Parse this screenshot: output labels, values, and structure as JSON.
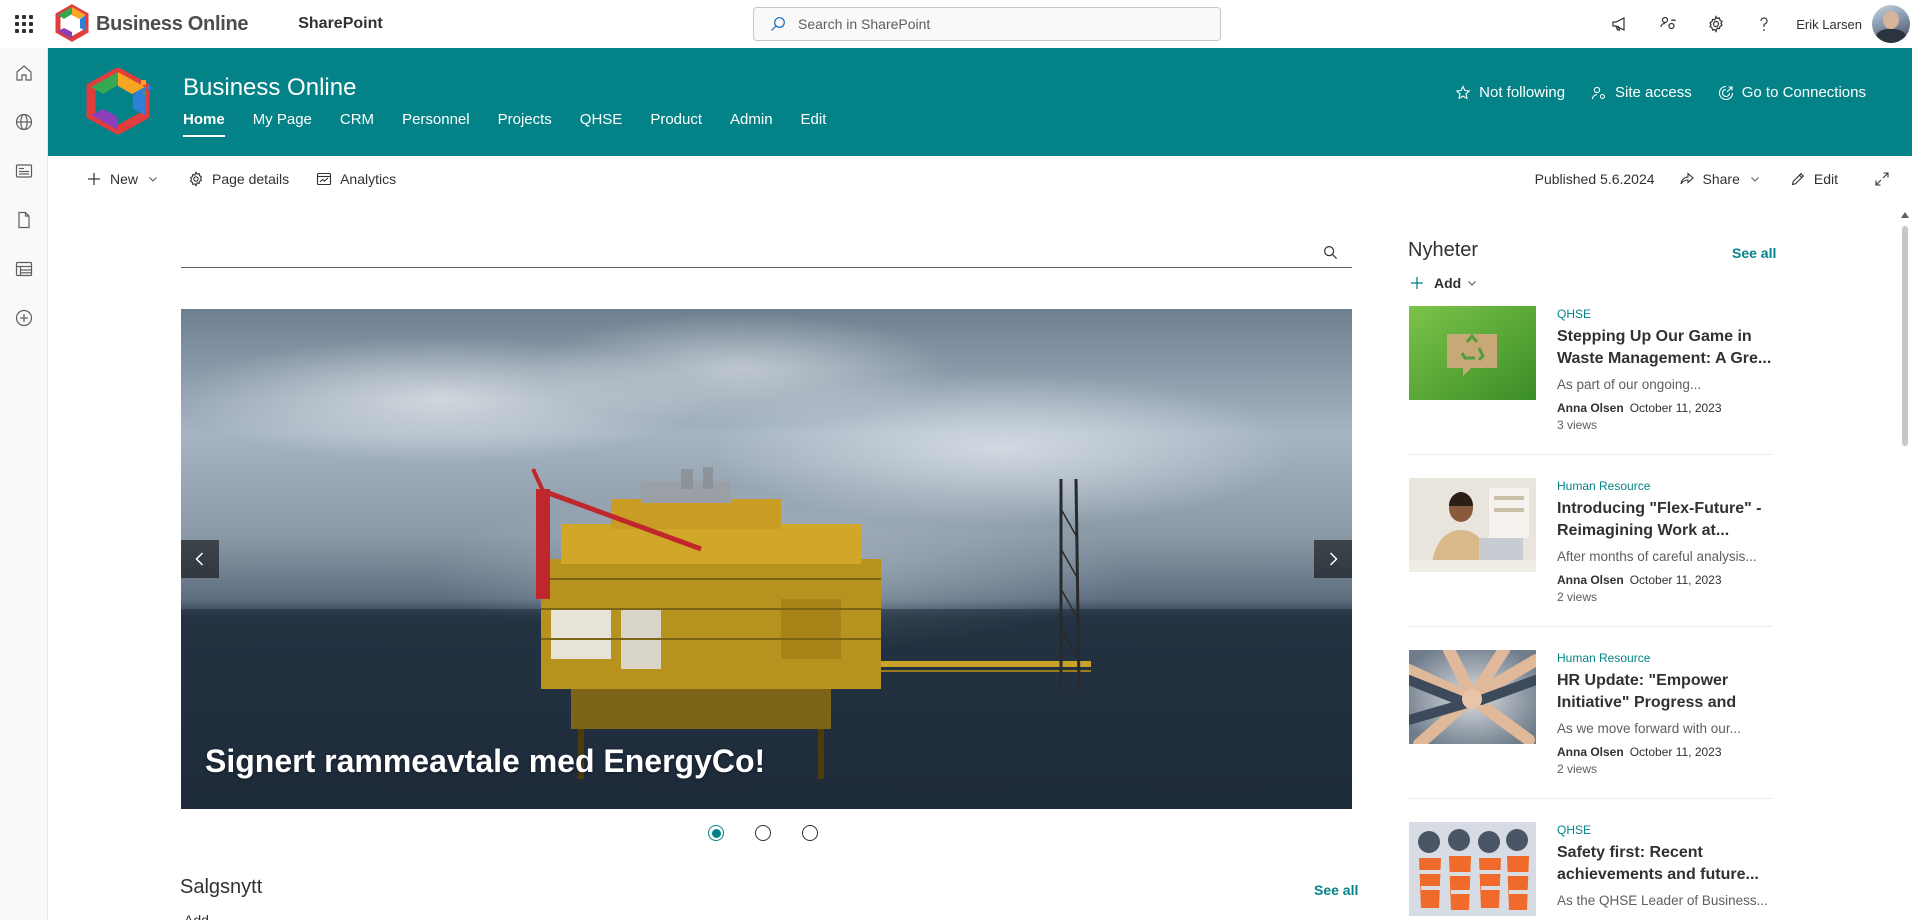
{
  "suite": {
    "brand": "Business Online",
    "app": "SharePoint",
    "search_placeholder": "Search in SharePoint",
    "user_name": "Erik Larsen"
  },
  "site": {
    "title": "Business Online",
    "nav": [
      "Home",
      "My Page",
      "CRM",
      "Personnel",
      "Projects",
      "QHSE",
      "Product",
      "Admin",
      "Edit"
    ],
    "active_nav": "Home",
    "actions": {
      "follow": "Not following",
      "access": "Site access",
      "connections": "Go to Connections"
    },
    "accent": "#038387"
  },
  "commandbar": {
    "new": "New",
    "page_details": "Page details",
    "analytics": "Analytics",
    "published": "Published 5.6.2024",
    "share": "Share",
    "edit": "Edit"
  },
  "hero": {
    "title": "Signert rammeavtale med EnergyCo!",
    "slide_count": 3,
    "active_slide": 1
  },
  "salgsnytt": {
    "title": "Salgsnytt",
    "see_all": "See all",
    "add": "Add"
  },
  "news": {
    "title": "Nyheter",
    "see_all": "See all",
    "add": "Add",
    "items": [
      {
        "category": "QHSE",
        "headline": "Stepping Up Our Game in Waste Management: A Gre...",
        "description": "As part of our ongoing...",
        "author": "Anna Olsen",
        "date": "October 11, 2023",
        "views": "3 views"
      },
      {
        "category": "Human Resource",
        "headline": "Introducing \"Flex-Future\" - Reimagining Work at...",
        "description": "After months of careful analysis...",
        "author": "Anna Olsen",
        "date": "October 11, 2023",
        "views": "2 views"
      },
      {
        "category": "Human Resource",
        "headline": "HR Update: \"Empower Initiative\" Progress and Ne...",
        "description": "As we move forward with our...",
        "author": "Anna Olsen",
        "date": "October 11, 2023",
        "views": "2 views"
      },
      {
        "category": "QHSE",
        "headline": "Safety first: Recent achievements and future...",
        "description": "As the QHSE Leader of Business...",
        "author": "",
        "date": "",
        "views": ""
      }
    ]
  }
}
